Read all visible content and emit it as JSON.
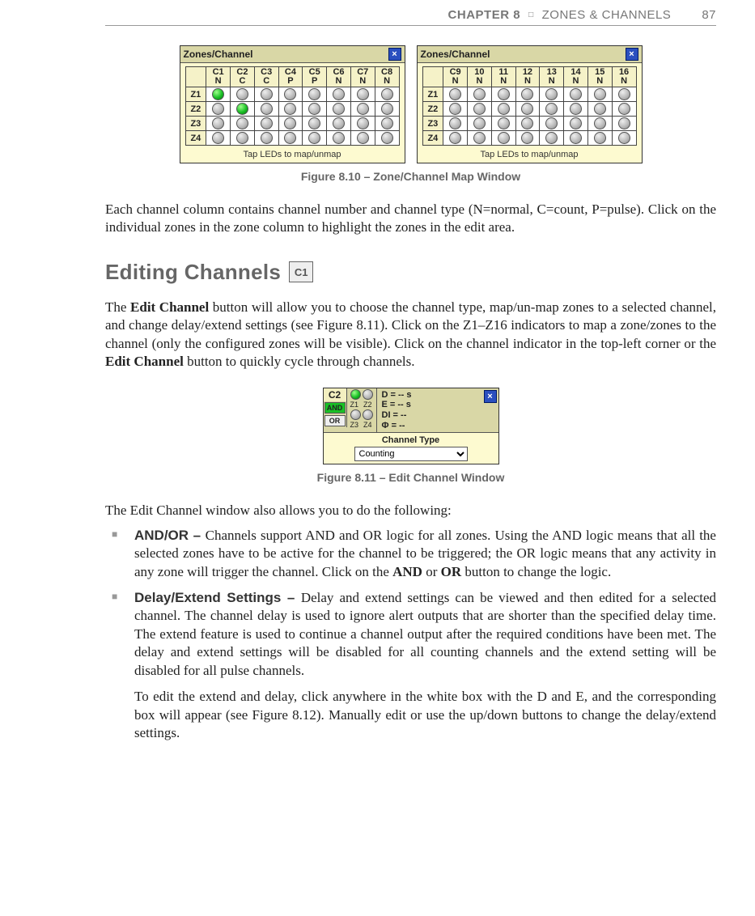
{
  "header": {
    "chapter_label": "CHAPTER 8",
    "separator": "□",
    "chapter_title": "ZONES & CHANNELS",
    "page_number": "87"
  },
  "fig810": {
    "caption": "Figure 8.10 – Zone/Channel Map Window",
    "panel_title": "Zones/Channel",
    "tap_caption": "Tap LEDs to map/unmap",
    "close": "×",
    "left": {
      "cols": [
        {
          "id": "C1",
          "type": "N"
        },
        {
          "id": "C2",
          "type": "C"
        },
        {
          "id": "C3",
          "type": "C"
        },
        {
          "id": "C4",
          "type": "P"
        },
        {
          "id": "C5",
          "type": "P"
        },
        {
          "id": "C6",
          "type": "N"
        },
        {
          "id": "C7",
          "type": "N"
        },
        {
          "id": "C8",
          "type": "N"
        }
      ],
      "rows": [
        "Z1",
        "Z2",
        "Z3",
        "Z4"
      ],
      "on": [
        [
          0,
          0
        ],
        [
          1,
          1
        ]
      ]
    },
    "right": {
      "cols": [
        {
          "id": "C9",
          "type": "N"
        },
        {
          "id": "10",
          "type": "N"
        },
        {
          "id": "11",
          "type": "N"
        },
        {
          "id": "12",
          "type": "N"
        },
        {
          "id": "13",
          "type": "N"
        },
        {
          "id": "14",
          "type": "N"
        },
        {
          "id": "15",
          "type": "N"
        },
        {
          "id": "16",
          "type": "N"
        }
      ],
      "rows": [
        "Z1",
        "Z2",
        "Z3",
        "Z4"
      ],
      "on": []
    }
  },
  "para1": "Each channel column contains channel number and channel type (N=normal, C=count, P=pulse). Click on the individual zones in the zone column to highlight the zones in the edit area.",
  "section": {
    "title": "Editing Channels",
    "icon": "C1"
  },
  "para2_parts": {
    "a": "The ",
    "b": "Edit Channel",
    "c": " button will allow you to choose the channel type, map/un-map zones to a selected channel, and change delay/extend settings (see Figure 8.11). Click on the Z1–Z16 indicators to map a zone/zones to the channel (only the configured zones will be visible). Click on the channel indicator in the top-left corner or the ",
    "d": "Edit Channel",
    "e": " button to quickly cycle through channels."
  },
  "fig811": {
    "caption": "Figure 8.11 – Edit Channel Window",
    "channel": "C2",
    "and": "AND",
    "or": "OR",
    "z_top": [
      "Z1",
      "Z2"
    ],
    "z_bot": [
      "Z3",
      "Z4"
    ],
    "vals": {
      "d": "D = -- s",
      "e": "E = -- s",
      "di": "DI = --",
      "phi": "Φ = --"
    },
    "ct_label": "Channel Type",
    "ct_value": "Counting",
    "close": "×"
  },
  "para3": "The Edit Channel window also allows you to do the following:",
  "bullets": {
    "andor": {
      "label": "AND/OR – ",
      "text_a": "Channels support AND and OR logic for all zones. Using the AND logic means that all the selected zones have to be active for the channel to be triggered; the OR logic means that any activity in any zone will trigger the channel. Click on the ",
      "b1": "AND",
      "mid": " or ",
      "b2": "OR",
      "text_b": " button to change the logic."
    },
    "delay": {
      "label": "Delay/Extend Settings – ",
      "text": "Delay and extend settings can be viewed and then edited for a selected channel. The channel delay is used to ignore alert outputs that are shorter than the specified delay time. The extend feature is used to continue a channel output after the required conditions have been met. The delay and extend settings will be disabled for all counting channels and the extend setting will be disabled for all pulse channels.",
      "extra": "To edit the extend and delay, click anywhere in the white box with the D and E, and the corresponding box will appear (see Figure 8.12). Manually edit or use the up/down buttons to change the delay/extend settings."
    }
  }
}
